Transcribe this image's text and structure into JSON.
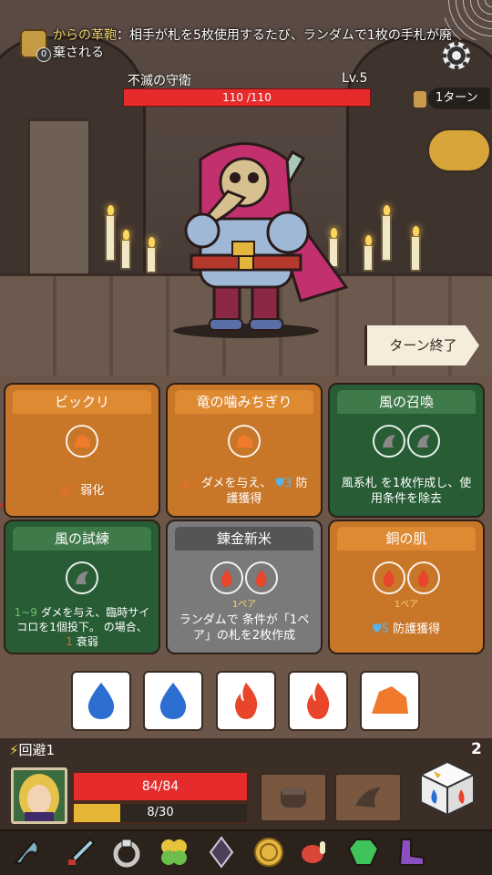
{
  "relic": {
    "name": "からの革鞄",
    "count": "0",
    "text": "：相手が札を5枚使用するたび、ランダムで1枚の手札が廃棄される"
  },
  "enemy": {
    "name": "不滅の守衛",
    "level": "Lv.5",
    "hp_text": "110 /110",
    "hp_fraction": 1.0
  },
  "turn": {
    "text": "1ターン"
  },
  "end_turn": {
    "label": "ターン終了"
  },
  "cards": [
    {
      "title": "ビックリ",
      "color": "#c87628",
      "slots": [
        "rock"
      ],
      "pair": "",
      "desc_num": "2",
      "desc": "弱化",
      "desc_icon": "rock"
    },
    {
      "title": "竜の噛みちぎり",
      "color": "#c87628",
      "slots": [
        "rock"
      ],
      "pair": "",
      "desc_num": "3",
      "desc": "ダメを与え、",
      "desc_num2": "3",
      "desc2": "防",
      "desc3": "護獲得"
    },
    {
      "title": "風の召喚",
      "color": "#275c35",
      "slots": [
        "wind",
        "wind"
      ],
      "pair": "",
      "desc": "風系札 を1枚作成し、使用条件を除去"
    },
    {
      "title": "風の試練",
      "color": "#275c35",
      "slots": [
        "wind"
      ],
      "pair": "",
      "desc_num": "1~9",
      "desc": "ダメを与え、臨時サイコロを1個投下。",
      "desc3": "の場合、",
      "desc_num2": "1",
      "desc4": "衰弱"
    },
    {
      "title": "錬金新米",
      "color": "#7a7a7a",
      "slots": [
        "fire",
        "fire"
      ],
      "pair": "1ペア",
      "desc": "ランダムで 条件が「1ペア」の札を2枚作成"
    },
    {
      "title": "銅の肌",
      "color": "#c87628",
      "slots": [
        "fire",
        "fire"
      ],
      "pair": "1ペア",
      "desc_num": "5",
      "desc": "防護獲得"
    }
  ],
  "dice": [
    {
      "face": "water"
    },
    {
      "face": "water"
    },
    {
      "face": "fire"
    },
    {
      "face": "fire"
    },
    {
      "face": "rock"
    }
  ],
  "player": {
    "buff_label": "回避1",
    "hp_text": "84/84",
    "hp_fraction": 1.0,
    "xp_text": "8/30",
    "xp_fraction": 0.267,
    "dice_count": "2"
  },
  "relic_row": [
    "scythe-icon",
    "dagger-icon",
    "ring-icon",
    "clover-icon",
    "crystal-icon",
    "gold-coin-icon",
    "meat-icon",
    "emerald-icon",
    "boot-icon"
  ],
  "colors": {
    "hp": "#e52b2b",
    "xp": "#e6b534",
    "fire": "#e8452a",
    "water": "#2d6fd0",
    "rock": "#f07a2c",
    "wind": "#7a7a7a"
  }
}
